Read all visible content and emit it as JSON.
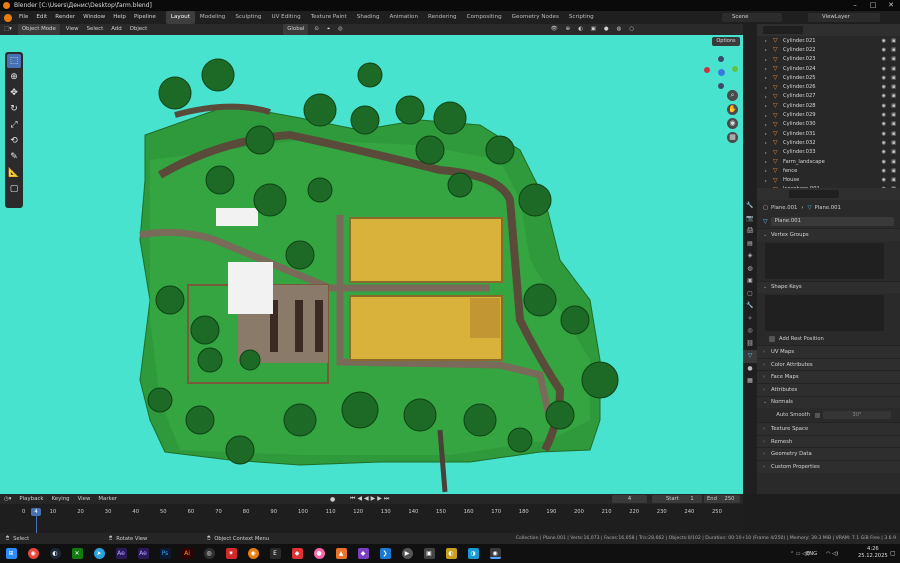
{
  "window": {
    "title": "Blender [C:\\Users\\Денис\\Desktop\\farm.blend]"
  },
  "menus": [
    "File",
    "Edit",
    "Render",
    "Window",
    "Help",
    "Pipeline"
  ],
  "workspaces": [
    "Layout",
    "Modeling",
    "Sculpting",
    "UV Editing",
    "Texture Paint",
    "Shading",
    "Animation",
    "Rendering",
    "Compositing",
    "Geometry Nodes",
    "Scripting"
  ],
  "scene": {
    "name": "Scene",
    "view_layer": "ViewLayer"
  },
  "viewport_header": {
    "mode": "Object Mode",
    "view": "View",
    "select": "Select",
    "add": "Add",
    "object": "Object",
    "transform": "Global",
    "options": "Options"
  },
  "outliner": {
    "items": [
      "Cylinder.021",
      "Cylinder.022",
      "Cylinder.023",
      "Cylinder.024",
      "Cylinder.025",
      "Cylinder.026",
      "Cylinder.027",
      "Cylinder.028",
      "Cylinder.029",
      "Cylinder.030",
      "Cylinder.031",
      "Cylinder.032",
      "Cylinder.033",
      "Farm_landscape",
      "fence",
      "House",
      "Icosphere.001"
    ]
  },
  "properties": {
    "breadcrumb_obj": "Plane.001",
    "breadcrumb_data": "Plane.001",
    "mesh_name": "Plane.001",
    "vertex_groups": "Vertex Groups",
    "shape_keys": "Shape Keys",
    "add_rest_position": "Add Rest Position",
    "sections": [
      "UV Maps",
      "Color Attributes",
      "Face Maps",
      "Attributes",
      "Normals"
    ],
    "auto_smooth": "Auto Smooth",
    "auto_smooth_value": "30°",
    "sections2": [
      "Texture Space",
      "Remesh",
      "Geometry Data",
      "Custom Properties"
    ]
  },
  "timeline": {
    "playback": "Playback",
    "keying": "Keying",
    "view": "View",
    "marker": "Marker",
    "current_frame": "4",
    "start_label": "Start",
    "start": "1",
    "end_label": "End",
    "end": "250",
    "ticks": [
      "0",
      "10",
      "20",
      "30",
      "40",
      "50",
      "60",
      "70",
      "80",
      "90",
      "100",
      "110",
      "120",
      "130",
      "140",
      "150",
      "160",
      "170",
      "180",
      "190",
      "200",
      "210",
      "220",
      "230",
      "240",
      "250"
    ]
  },
  "statusbar": {
    "select": "Select",
    "rotate": "Rotate View",
    "context": "Object Context Menu",
    "stats": "Collection | Plane.001 | Verts:16,073 | Faces:16,058 | Tris:28,662 | Objects:0/102 | Duration: 00:10+10 (Frame 4/250) | Memory: 39.3 MiB | VRAM: 7.1 GiB Free | 3.6.9"
  },
  "taskbar": {
    "lang": "ENG",
    "time": "4:26",
    "date": "25.12.2025"
  },
  "colors": {
    "viewport_bg": "#48e3cf",
    "accent": "#4772b3",
    "grass": "#2f9a3b",
    "field": "#d8b23a",
    "tree": "#1c6a25"
  }
}
